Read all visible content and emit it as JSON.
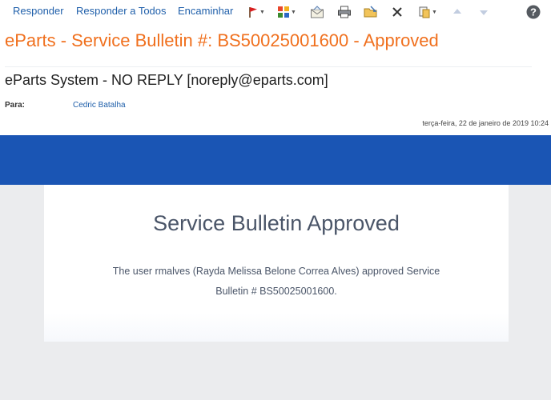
{
  "toolbar": {
    "reply_label": "Responder",
    "reply_all_label": "Responder a Todos",
    "forward_label": "Encaminhar",
    "icons": [
      "flag-icon",
      "categories-icon",
      "mark-unread-icon",
      "print-icon",
      "move-folder-icon",
      "delete-icon",
      "copy-icon",
      "previous-arrow-icon",
      "next-arrow-icon",
      "help-icon"
    ],
    "help_glyph": "?"
  },
  "email": {
    "subject": "eParts - Service Bulletin #: BS50025001600 - Approved",
    "sender": "eParts System - NO REPLY [noreply@eparts.com]",
    "to_label": "Para:",
    "to_value": "Cedric Batalha",
    "date": "terça-feira, 22 de janeiro de 2019 10:24"
  },
  "message": {
    "title": "Service Bulletin Approved",
    "body": "The user rmalves (Rayda Melissa Belone Correa Alves) approved Service Bulletin # BS50025001600."
  },
  "colors": {
    "subject": "#f0701e",
    "link": "#1f5faa",
    "banner": "#1a55b4",
    "background": "#ebecee",
    "text": "#4a5568"
  }
}
